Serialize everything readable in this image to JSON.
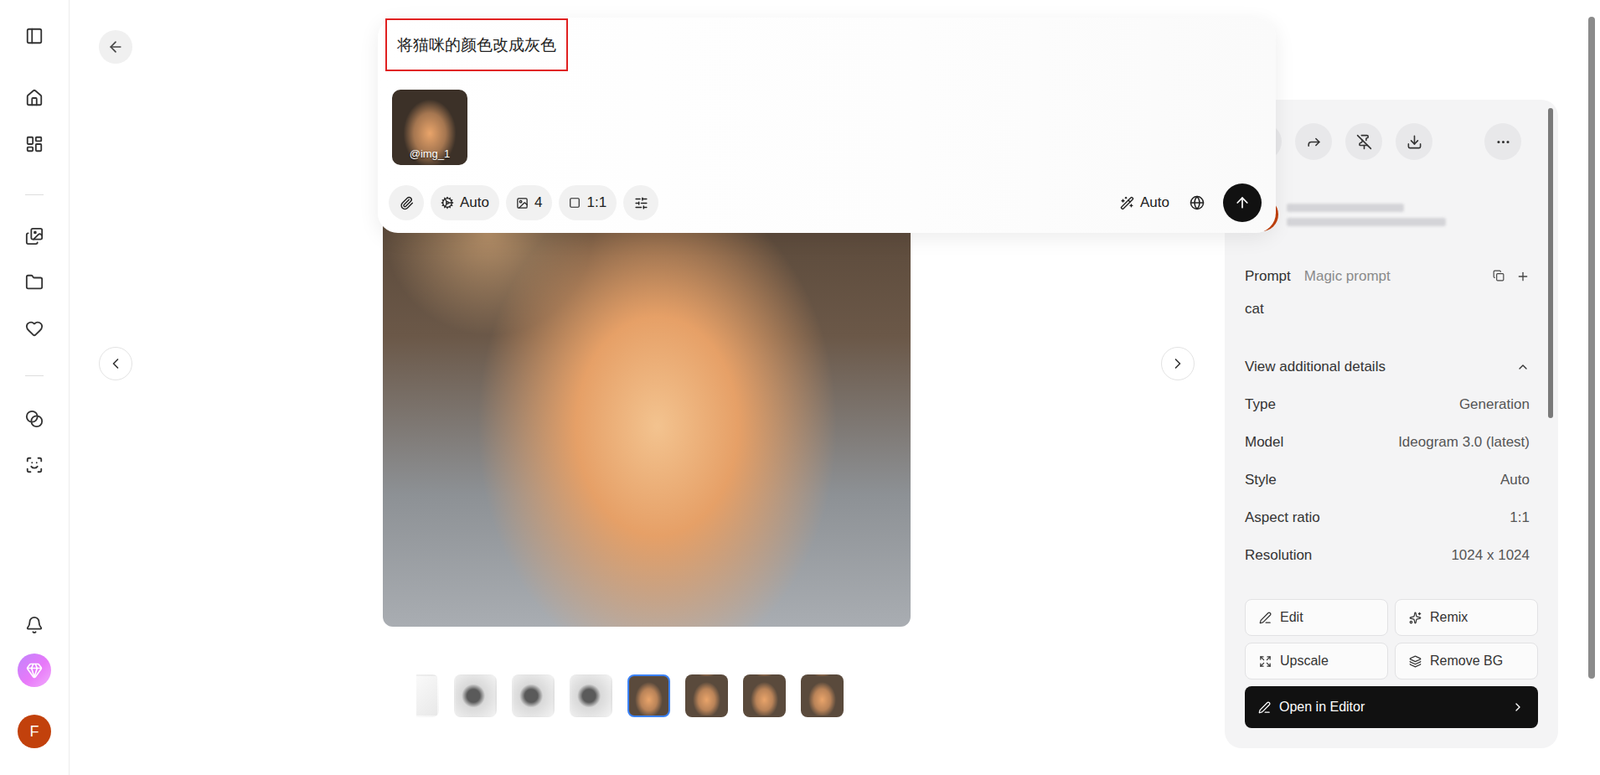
{
  "sidebar": {
    "avatar": "F"
  },
  "prompt_box": {
    "text": "将猫咪的颜色改成灰色",
    "highlighted": true,
    "attachments": [
      {
        "label": "@img_1"
      }
    ],
    "toolbar": {
      "style": "Auto",
      "count": "4",
      "aspect": "1:1",
      "magic": "Auto"
    }
  },
  "viewer": {
    "thumbnails": [
      {
        "kind": "white",
        "selected": false
      },
      {
        "kind": "product",
        "selected": false
      },
      {
        "kind": "product",
        "selected": false
      },
      {
        "kind": "product",
        "selected": false
      },
      {
        "kind": "cat",
        "selected": true
      },
      {
        "kind": "cat",
        "selected": false
      },
      {
        "kind": "cat",
        "selected": false
      },
      {
        "kind": "cat",
        "selected": false
      }
    ]
  },
  "details": {
    "prompt_label": "Prompt",
    "magic_prompt": "Magic prompt",
    "prompt": "cat",
    "toggle": {
      "label": "View additional details",
      "expanded": true
    },
    "rows": [
      {
        "label": "Type",
        "value": "Generation"
      },
      {
        "label": "Model",
        "value": "Ideogram 3.0 (latest)"
      },
      {
        "label": "Style",
        "value": "Auto"
      },
      {
        "label": "Aspect ratio",
        "value": "1:1"
      },
      {
        "label": "Resolution",
        "value": "1024 x 1024"
      }
    ]
  },
  "buttons": [
    "Edit",
    "Remix",
    "Upscale",
    "Remove BG"
  ],
  "primary_button": "Open in Editor"
}
